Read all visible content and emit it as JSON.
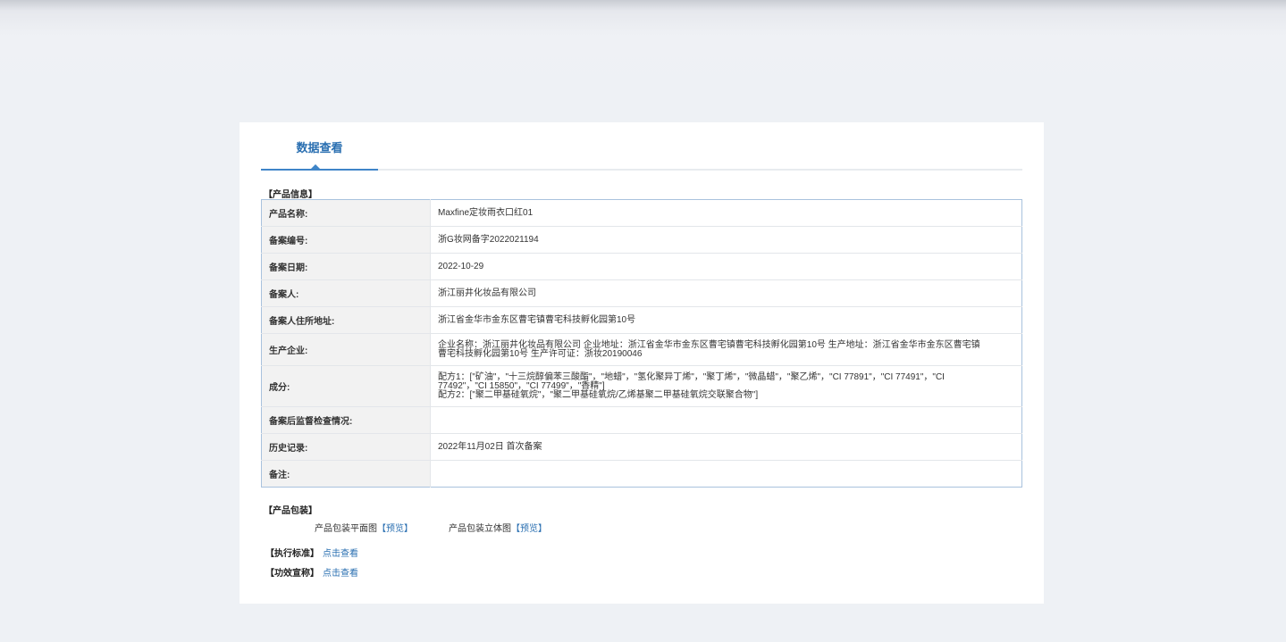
{
  "tab": {
    "label": "数据查看"
  },
  "product_info": {
    "title": "【产品信息】",
    "rows": [
      {
        "label": "产品名称:",
        "value": "Maxfine定妆雨衣口红01"
      },
      {
        "label": "备案编号:",
        "value": "浙G妆网备字2022021194"
      },
      {
        "label": "备案日期:",
        "value": "2022-10-29"
      },
      {
        "label": "备案人:",
        "value": "浙江丽井化妆品有限公司"
      },
      {
        "label": "备案人住所地址:",
        "value": "浙江省金华市金东区曹宅镇曹宅科技孵化园第10号"
      },
      {
        "label": "生产企业:",
        "value": "企业名称：浙江丽井化妆品有限公司 企业地址：浙江省金华市金东区曹宅镇曹宅科技孵化园第10号 生产地址：浙江省金华市金东区曹宅镇曹宅科技孵化园第10号 生产许可证：浙妆20190046"
      },
      {
        "label": "成分:",
        "value_lines": [
          "配方1：[\"矿油\"，\"十三烷醇偏苯三酸酯\"，\"地蜡\"，\"氢化聚异丁烯\"，\"聚丁烯\"，\"微晶蜡\"，\"聚乙烯\"，\"CI 77891\"，\"CI 77491\"，\"CI 77492\"，\"CI 15850\"，\"CI 77499\"，\"香精\"]",
          "配方2：[\"聚二甲基硅氧烷\"，\"聚二甲基硅氧烷/乙烯基聚二甲基硅氧烷交联聚合物\"]"
        ]
      },
      {
        "label": "备案后监督检查情况:",
        "value": ""
      },
      {
        "label": "历史记录:",
        "value": "2022年11月02日 首次备案"
      },
      {
        "label": "备注:",
        "value": ""
      }
    ]
  },
  "packaging": {
    "title": "【产品包装】",
    "items": [
      {
        "label": "产品包装平面图",
        "link": "预览"
      },
      {
        "label": "产品包装立体图",
        "link": "预览"
      }
    ]
  },
  "standard": {
    "label": "【执行标准】",
    "link": "点击查看"
  },
  "claims": {
    "label": "【功效宣称】",
    "link": "点击查看"
  }
}
